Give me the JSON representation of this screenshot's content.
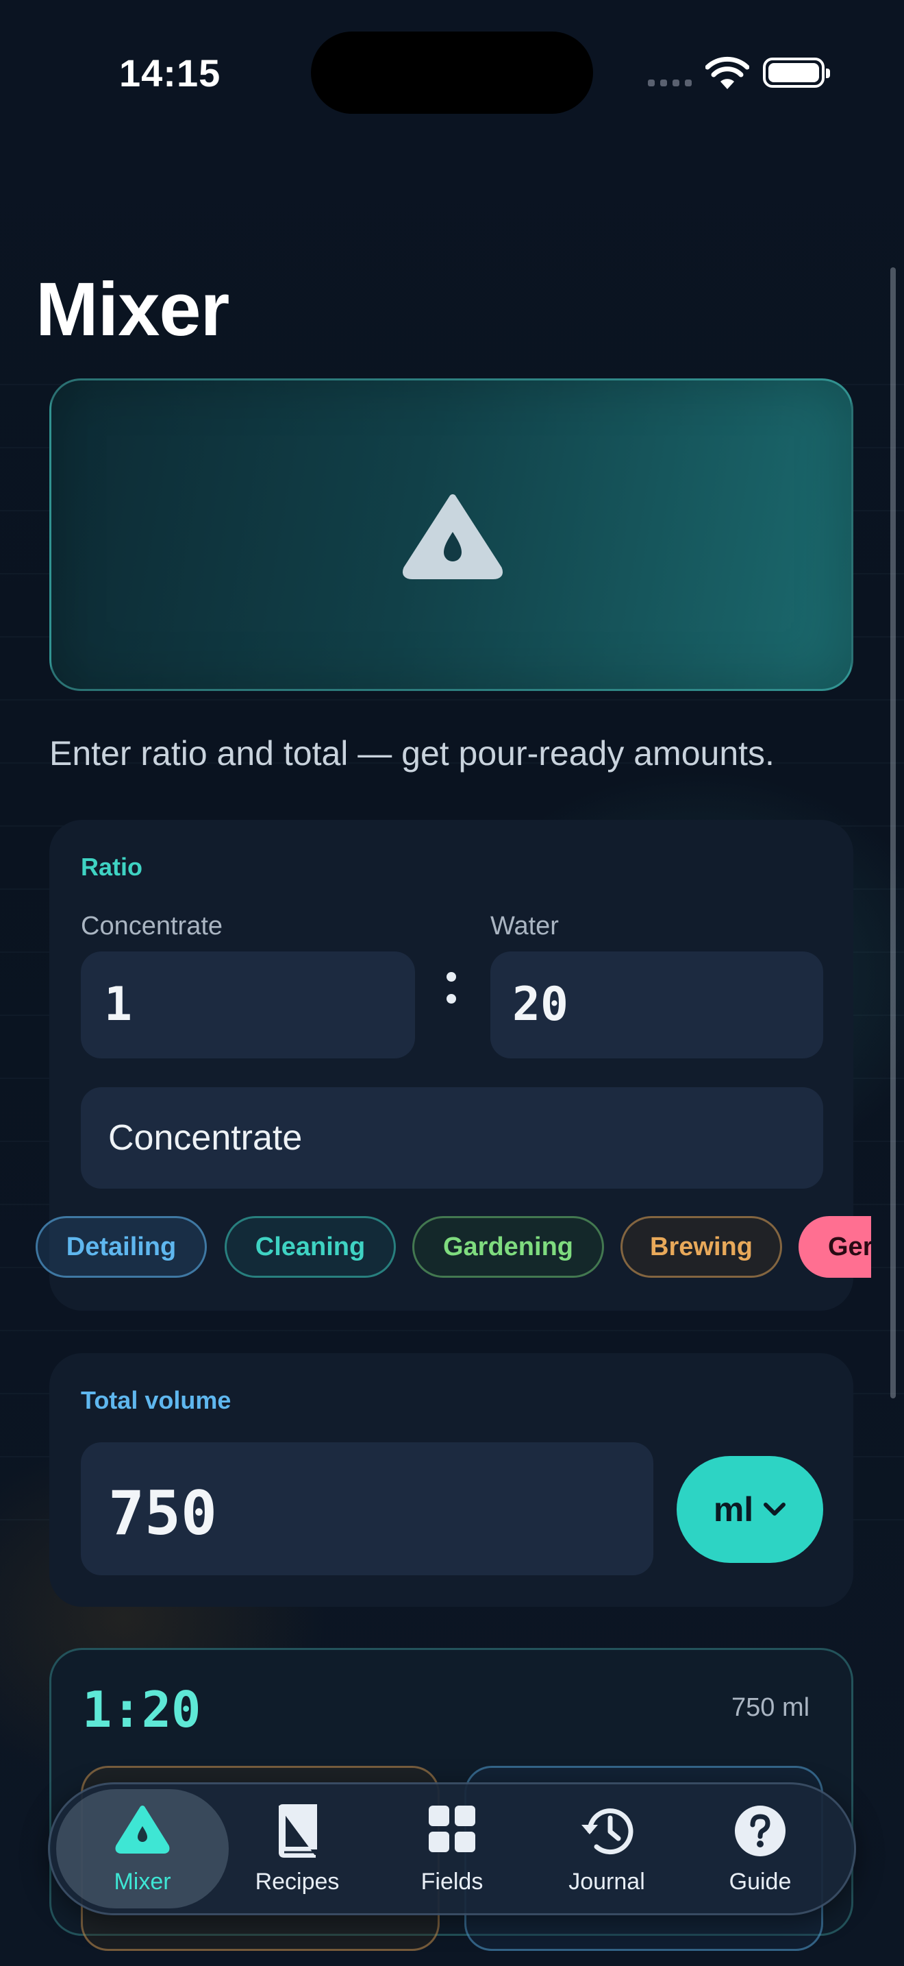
{
  "status": {
    "time": "14:15"
  },
  "header": {
    "title": "Mixer"
  },
  "tagline": "Enter ratio and total — get pour-ready amounts.",
  "ratio": {
    "section_label": "Ratio",
    "concentrate_label": "Concentrate",
    "concentrate_value": "1",
    "water_label": "Water",
    "water_value": "20",
    "product_name": "Concentrate"
  },
  "categories": [
    {
      "label": "Detailing",
      "color": "#5fb7ef"
    },
    {
      "label": "Cleaning",
      "color": "#3fd3c3"
    },
    {
      "label": "Gardening",
      "color": "#7fdc7f"
    },
    {
      "label": "Brewing",
      "color": "#e8a95a"
    },
    {
      "label": "Ger",
      "color": "#ff6f91"
    }
  ],
  "volume": {
    "section_label": "Total volume",
    "value": "750",
    "unit": "ml"
  },
  "result": {
    "ratio": "1:20",
    "total": "750 ml"
  },
  "tabs": [
    {
      "label": "Mixer",
      "icon": "drop-icon",
      "active": true
    },
    {
      "label": "Recipes",
      "icon": "book-icon",
      "active": false
    },
    {
      "label": "Fields",
      "icon": "grid-icon",
      "active": false
    },
    {
      "label": "Journal",
      "icon": "history-icon",
      "active": false
    },
    {
      "label": "Guide",
      "icon": "help-icon",
      "active": false
    }
  ],
  "colors": {
    "accent": "#2dd4c4",
    "background": "#0a1320",
    "card": "#111c2c",
    "input": "#1c2a40"
  }
}
